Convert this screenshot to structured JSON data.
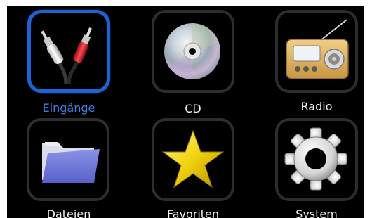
{
  "menu": {
    "items": [
      {
        "label": "Eingänge",
        "icon": "audio-cables-icon",
        "selected": true
      },
      {
        "label": "CD",
        "icon": "cd-disc-icon",
        "selected": false
      },
      {
        "label": "Radio",
        "icon": "radio-icon",
        "selected": false
      },
      {
        "label": "Dateien",
        "icon": "folder-icon",
        "selected": false
      },
      {
        "label": "Favoriten",
        "icon": "star-icon",
        "selected": false
      },
      {
        "label": "System",
        "icon": "gear-icon",
        "selected": false
      }
    ]
  },
  "colors": {
    "background": "#000000",
    "tile_border": "#2d2d2d",
    "selected_border": "#1e63d6",
    "selected_label": "#3e7fe0",
    "label": "#f2f2f2"
  }
}
